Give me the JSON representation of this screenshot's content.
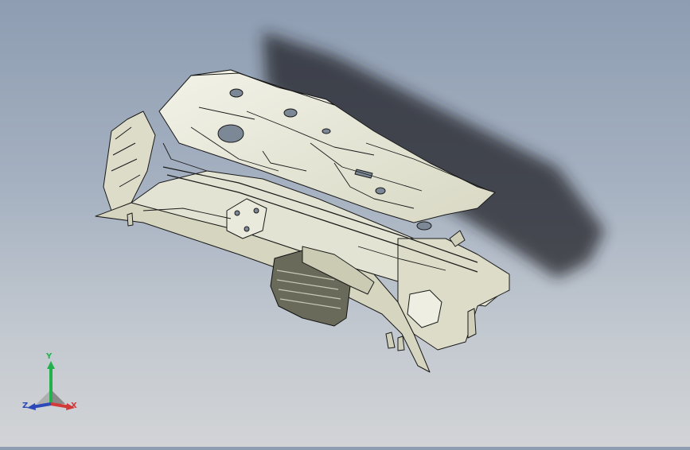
{
  "viewport": {
    "background_top": "#8e9db2",
    "background_bottom": "#d2d4d6",
    "shadow_color": "#1e1e22",
    "model": {
      "body_color": "#e3e3d3",
      "light_color": "#f1f1e6",
      "dark_color": "#cbcbb4",
      "edge_color": "#1a1a1a",
      "hole_color": "#7d8896"
    }
  },
  "triad": {
    "x_label": "X",
    "y_label": "Y",
    "z_label": "Z",
    "x_color": "#d23a3a",
    "y_color": "#22b14c",
    "z_color": "#2c49b8"
  }
}
